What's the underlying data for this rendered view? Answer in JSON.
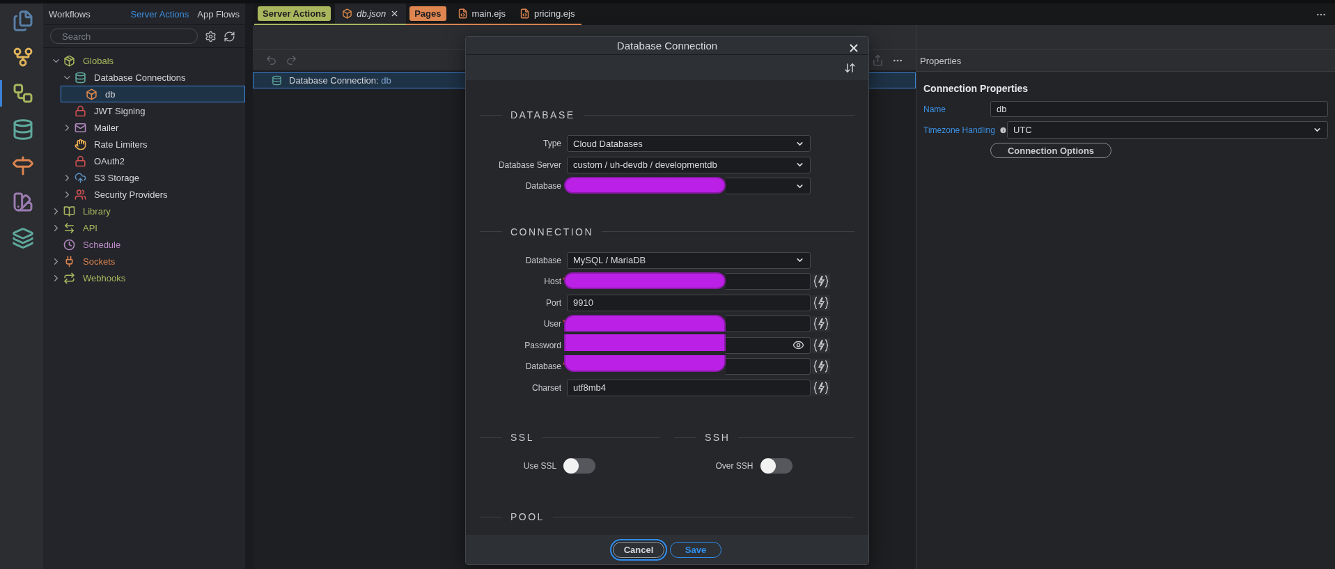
{
  "activity_bar": {
    "items": [
      {
        "kind": "pages",
        "selected": false
      },
      {
        "kind": "git",
        "selected": false
      },
      {
        "kind": "workflows",
        "selected": true
      },
      {
        "kind": "database",
        "selected": false
      },
      {
        "kind": "routing",
        "selected": false
      },
      {
        "kind": "design",
        "selected": false
      },
      {
        "kind": "layers",
        "selected": false
      }
    ]
  },
  "sidebar": {
    "title": "Workflows",
    "tabs": [
      {
        "label": "Server Actions",
        "selected": true
      },
      {
        "label": "App Flows",
        "selected": false
      }
    ],
    "search": {
      "placeholder": "Search"
    },
    "tree": [
      {
        "label": "Globals",
        "kind": "package",
        "color": "#aab65e",
        "expanded": true,
        "selected": false,
        "children": [
          {
            "label": "Database Connections",
            "kind": "database",
            "color": "#d4d6da",
            "expanded": true,
            "selected": false,
            "children": [
              {
                "label": "db",
                "kind": "box",
                "color": "#d4d6da",
                "selected": true
              }
            ]
          },
          {
            "label": "JWT Signing",
            "kind": "lock",
            "color": "#d4d6da",
            "selected": false
          },
          {
            "label": "Mailer",
            "kind": "mail",
            "color": "#d4d6da",
            "expanded": false,
            "selected": false
          },
          {
            "label": "Rate Limiters",
            "kind": "hand",
            "color": "#d4d6da",
            "selected": false
          },
          {
            "label": "OAuth2",
            "kind": "lock",
            "color": "#d4d6da",
            "selected": false
          },
          {
            "label": "S3 Storage",
            "kind": "cloud",
            "color": "#d4d6da",
            "expanded": false,
            "selected": false
          },
          {
            "label": "Security Providers",
            "kind": "users",
            "color": "#d4d6da",
            "expanded": false,
            "selected": false
          }
        ]
      },
      {
        "label": "Library",
        "kind": "book",
        "color": "#aab65e",
        "expanded": false,
        "selected": false
      },
      {
        "label": "API",
        "kind": "arrows",
        "color": "#aab65e",
        "expanded": false,
        "selected": false
      },
      {
        "label": "Schedule",
        "kind": "clock",
        "color": "#b98ac6",
        "selected": false
      },
      {
        "label": "Sockets",
        "kind": "plug",
        "color": "#de8550",
        "expanded": false,
        "selected": false
      },
      {
        "label": "Webhooks",
        "kind": "repeat",
        "color": "#aab65e",
        "expanded": false,
        "selected": false
      }
    ]
  },
  "tab_groups": [
    {
      "label": "Server Actions",
      "color": "#aab65e",
      "tabs": [
        {
          "label": "db.json",
          "kind": "box",
          "selected": true
        }
      ]
    },
    {
      "label": "Pages",
      "color": "#de8550",
      "tabs": [
        {
          "label": "main.ejs",
          "kind": "html",
          "selected": false
        },
        {
          "label": "pricing.ejs",
          "kind": "html",
          "selected": false
        }
      ]
    }
  ],
  "steps": [
    {
      "label": "Database Connection:",
      "value": "db",
      "selected": true
    }
  ],
  "properties": {
    "title": "Properties",
    "section": "Connection Properties",
    "fields": [
      {
        "kind": "input",
        "label": "Name",
        "value": "db"
      },
      {
        "kind": "select",
        "label": "Timezone Handling",
        "value": "UTC",
        "info": true
      }
    ],
    "button": "Connection Options"
  },
  "dialog": {
    "title": "Database Connection",
    "sections": [
      {
        "title": "DATABASE",
        "fields": [
          {
            "kind": "select",
            "label": "Type",
            "value": "Cloud Databases"
          },
          {
            "kind": "select",
            "label": "Database Server",
            "value": "custom / uh-devdb / developmentdb"
          },
          {
            "kind": "select",
            "label": "Database",
            "redacted": true
          }
        ]
      },
      {
        "title": "CONNECTION",
        "fields": [
          {
            "kind": "select",
            "label": "Database",
            "value": "MySQL / MariaDB"
          },
          {
            "kind": "text",
            "label": "Host",
            "required_mark": "*",
            "redacted": true
          },
          {
            "kind": "text",
            "label": "Port",
            "value": "9910"
          },
          {
            "kind": "text",
            "label": "User",
            "required_mark": "*",
            "redacted": true
          },
          {
            "kind": "password",
            "label": "Password",
            "redacted": true
          },
          {
            "kind": "text",
            "label": "Database",
            "required_mark": "*",
            "redacted": true
          },
          {
            "kind": "text",
            "label": "Charset",
            "value": "utf8mb4"
          }
        ]
      }
    ],
    "toggles": [
      {
        "section": "SSL",
        "label": "Use SSL",
        "on": false
      },
      {
        "section": "SSH",
        "label": "Over SSH",
        "on": false
      }
    ],
    "last_section": "POOL",
    "buttons": [
      {
        "label": "Cancel",
        "kind": "secondary",
        "focused": true
      },
      {
        "label": "Save",
        "kind": "primary",
        "focused": false
      }
    ]
  }
}
